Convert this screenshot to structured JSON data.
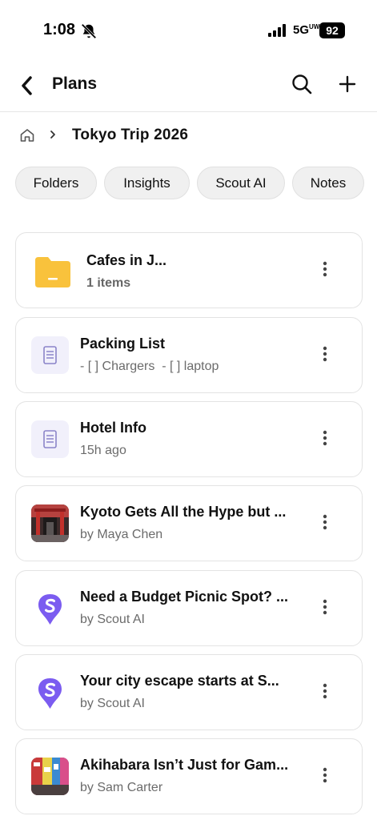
{
  "status": {
    "time": "1:08",
    "network": "5G",
    "network_sup": "UW",
    "battery": "92"
  },
  "header": {
    "title": "Plans"
  },
  "breadcrumb": {
    "current": "Tokyo Trip 2026"
  },
  "tabs": [
    "Folders",
    "Insights",
    "Scout AI",
    "Notes"
  ],
  "items": [
    {
      "title": "Cafes in J...",
      "subtitle": "1 items",
      "kind": "folder-icon"
    },
    {
      "title": "Packing List",
      "subtitle": "- [ ] Chargers  - [ ] laptop",
      "kind": "note-icon"
    },
    {
      "title": "Hotel Info",
      "subtitle": "15h ago",
      "kind": "note-icon"
    },
    {
      "title": "Kyoto Gets All the Hype but ...",
      "subtitle": "by Maya Chen",
      "kind": "photo-thumbnail"
    },
    {
      "title": "Need a Budget Picnic Spot? ...",
      "subtitle": "by Scout AI",
      "kind": "scout-ai-icon"
    },
    {
      "title": "Your city escape starts at S...",
      "subtitle": "by Scout AI",
      "kind": "scout-ai-icon"
    },
    {
      "title": "Akihabara Isn’t Just for Gam...",
      "subtitle": "by Sam Carter",
      "kind": "photo-thumbnail"
    }
  ],
  "colors": {
    "folder": "#f9c23c",
    "note_bg": "#f1f0fb",
    "note_icon": "#8b84c9",
    "scout": "#7b5cf0"
  }
}
